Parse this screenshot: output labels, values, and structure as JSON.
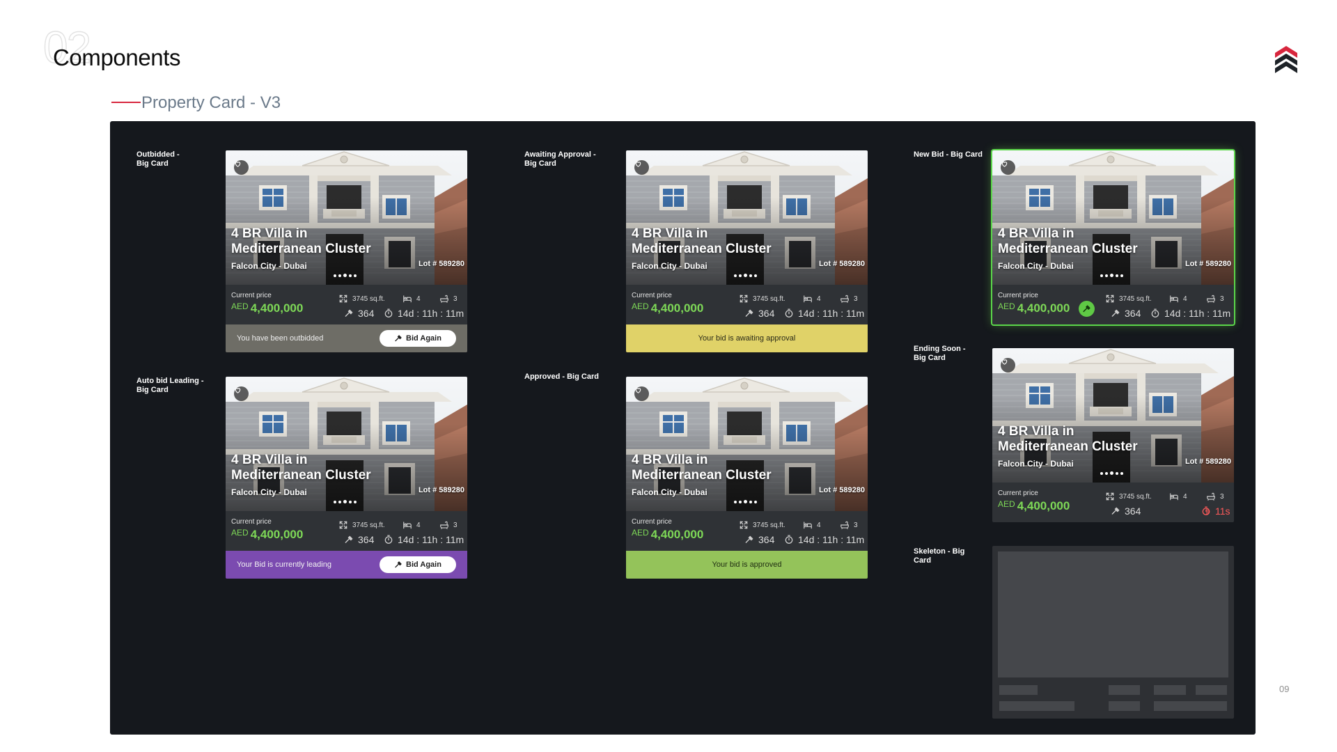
{
  "header": {
    "page_number_watermark": "02",
    "title": "Components",
    "subtitle": "Property Card - V3",
    "slide_number": "09"
  },
  "colors": {
    "accent_red": "#d7263d",
    "panel_bg": "#15181d",
    "price_green": "#7ed957",
    "outbid_bar": "#6e6d66",
    "awaiting_bar": "#e0d268",
    "leading_bar": "#7b4bb0",
    "approved_bar": "#94c35a",
    "new_bid_glow": "#5bd64a",
    "ending_red": "#ff5a5a"
  },
  "property": {
    "title": "4 BR Villa in Mediterranean Cluster",
    "location": "Falcon City - Dubai",
    "lot": "Lot # 589280",
    "price_label": "Current price",
    "currency": "AED",
    "price": "4,400,000",
    "area": "3745 sq.ft.",
    "beds": "4",
    "baths": "3",
    "bids": "364",
    "time_left": "14d : 11h : 11m"
  },
  "icons": {
    "favorite": "heart-icon",
    "area": "expand-arrows-icon",
    "beds": "bed-icon",
    "baths": "bathtub-icon",
    "bids": "gavel-icon",
    "timer": "stopwatch-icon",
    "brand": "chevrons-up-logo"
  },
  "labels": {
    "outbidded": "Outbidded - Big Card",
    "awaiting": "Awaiting Approval - Big Card",
    "new_bid": "New Bid - Big Card",
    "auto_bid": "Auto bid Leading - Big Card",
    "approved": "Approved - Big Card",
    "ending_soon": "Ending Soon - Big Card",
    "skeleton": "Skeleton - Big Card"
  },
  "status": {
    "outbidded": "You have been outbidded",
    "awaiting": "Your bid is awaiting approval",
    "leading": "Your Bid is currently leading",
    "approved": "Your bid is approved",
    "bid_again": "Bid Again"
  },
  "ending_soon": {
    "time_left": "11s"
  }
}
